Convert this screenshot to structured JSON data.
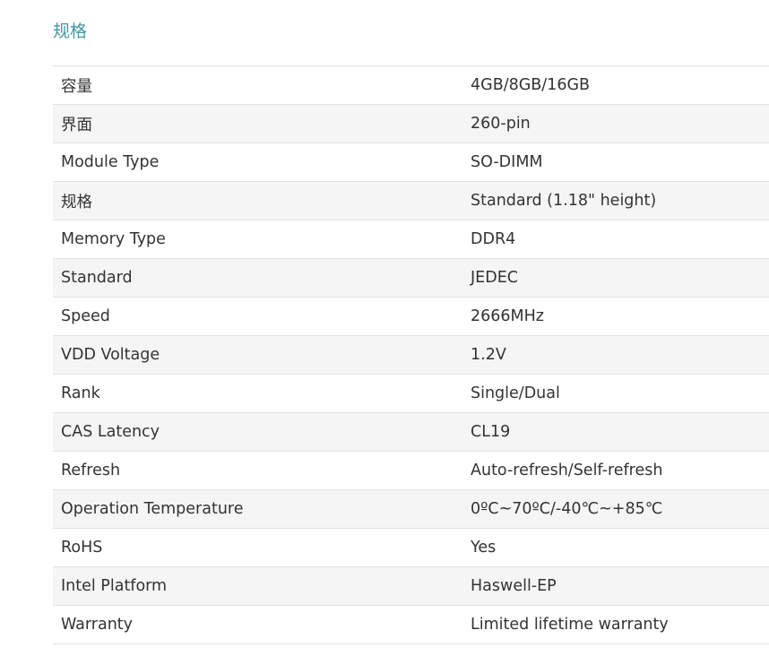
{
  "section": {
    "title": "规格"
  },
  "specs": [
    {
      "label": "容量",
      "value": "4GB/8GB/16GB"
    },
    {
      "label": "界面",
      "value": "260-pin"
    },
    {
      "label": "Module Type",
      "value": "SO-DIMM"
    },
    {
      "label": "规格",
      "value": "Standard (1.18\" height)"
    },
    {
      "label": "Memory Type",
      "value": "DDR4"
    },
    {
      "label": "Standard",
      "value": "JEDEC"
    },
    {
      "label": "Speed",
      "value": "2666MHz"
    },
    {
      "label": "VDD Voltage",
      "value": "1.2V"
    },
    {
      "label": "Rank",
      "value": "Single/Dual"
    },
    {
      "label": "CAS Latency",
      "value": "CL19"
    },
    {
      "label": "Refresh",
      "value": "Auto-refresh/Self-refresh"
    },
    {
      "label": "Operation Temperature",
      "value": "0ºC~70ºC/-40℃~+85℃"
    },
    {
      "label": "RoHS",
      "value": "Yes"
    },
    {
      "label": "Intel Platform",
      "value": "Haswell-EP"
    },
    {
      "label": "Warranty",
      "value": "Limited lifetime warranty"
    }
  ],
  "colors": {
    "title": "#3f9aa0",
    "text": "#333333",
    "row_alt": "#f5f5f5",
    "border": "#e2e2e2"
  }
}
